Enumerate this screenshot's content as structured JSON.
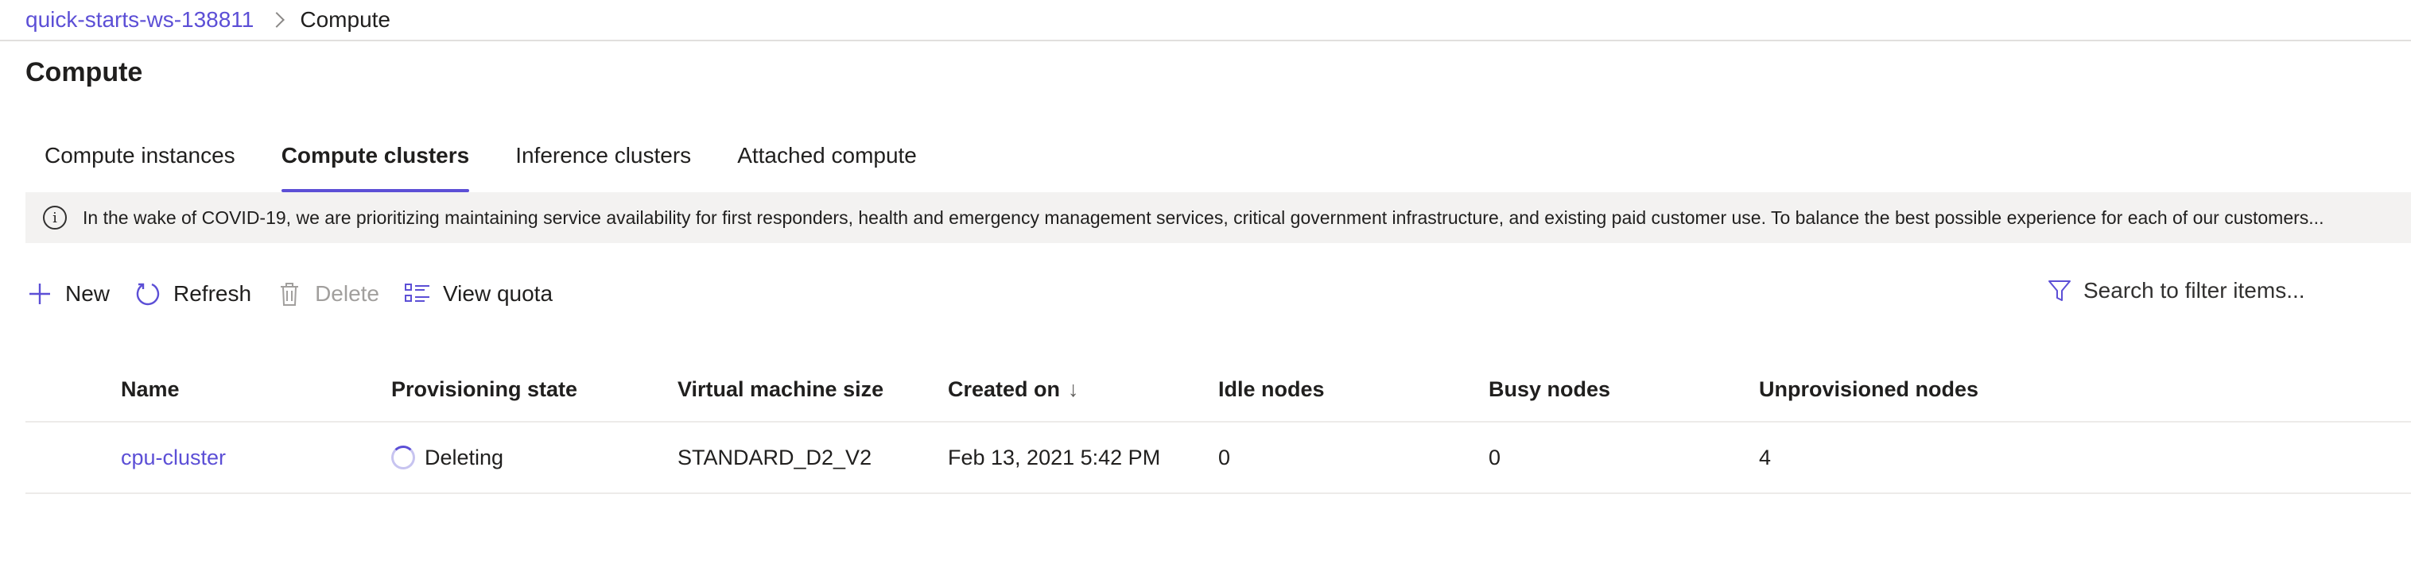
{
  "breadcrumb": {
    "workspace": "quick-starts-ws-138811",
    "current": "Compute"
  },
  "page": {
    "title": "Compute"
  },
  "tabs": [
    {
      "label": "Compute instances",
      "active": false
    },
    {
      "label": "Compute clusters",
      "active": true
    },
    {
      "label": "Inference clusters",
      "active": false
    },
    {
      "label": "Attached compute",
      "active": false
    }
  ],
  "banner": {
    "icon": "info-icon",
    "text": "In the wake of COVID-19, we are prioritizing maintaining service availability for first responders, health and emergency management services, critical government infrastructure, and existing paid customer use. To balance the best possible experience for each of our customers..."
  },
  "toolbar": {
    "new_label": "New",
    "refresh_label": "Refresh",
    "delete_label": "Delete",
    "view_quota_label": "View quota",
    "search_placeholder": "Search to filter items..."
  },
  "table": {
    "columns": [
      "Name",
      "Provisioning state",
      "Virtual machine size",
      "Created on",
      "Idle nodes",
      "Busy nodes",
      "Unprovisioned nodes"
    ],
    "sort_indicator": "↓",
    "rows": [
      {
        "name": "cpu-cluster",
        "state": "Deleting",
        "vm_size": "STANDARD_D2_V2",
        "created": "Feb 13, 2021 5:42 PM",
        "idle": "0",
        "busy": "0",
        "unprovisioned": "4"
      }
    ]
  },
  "colors": {
    "accent": "#5c4fd6",
    "banner_bg": "#f3f2f1",
    "disabled": "#a19f9d"
  }
}
